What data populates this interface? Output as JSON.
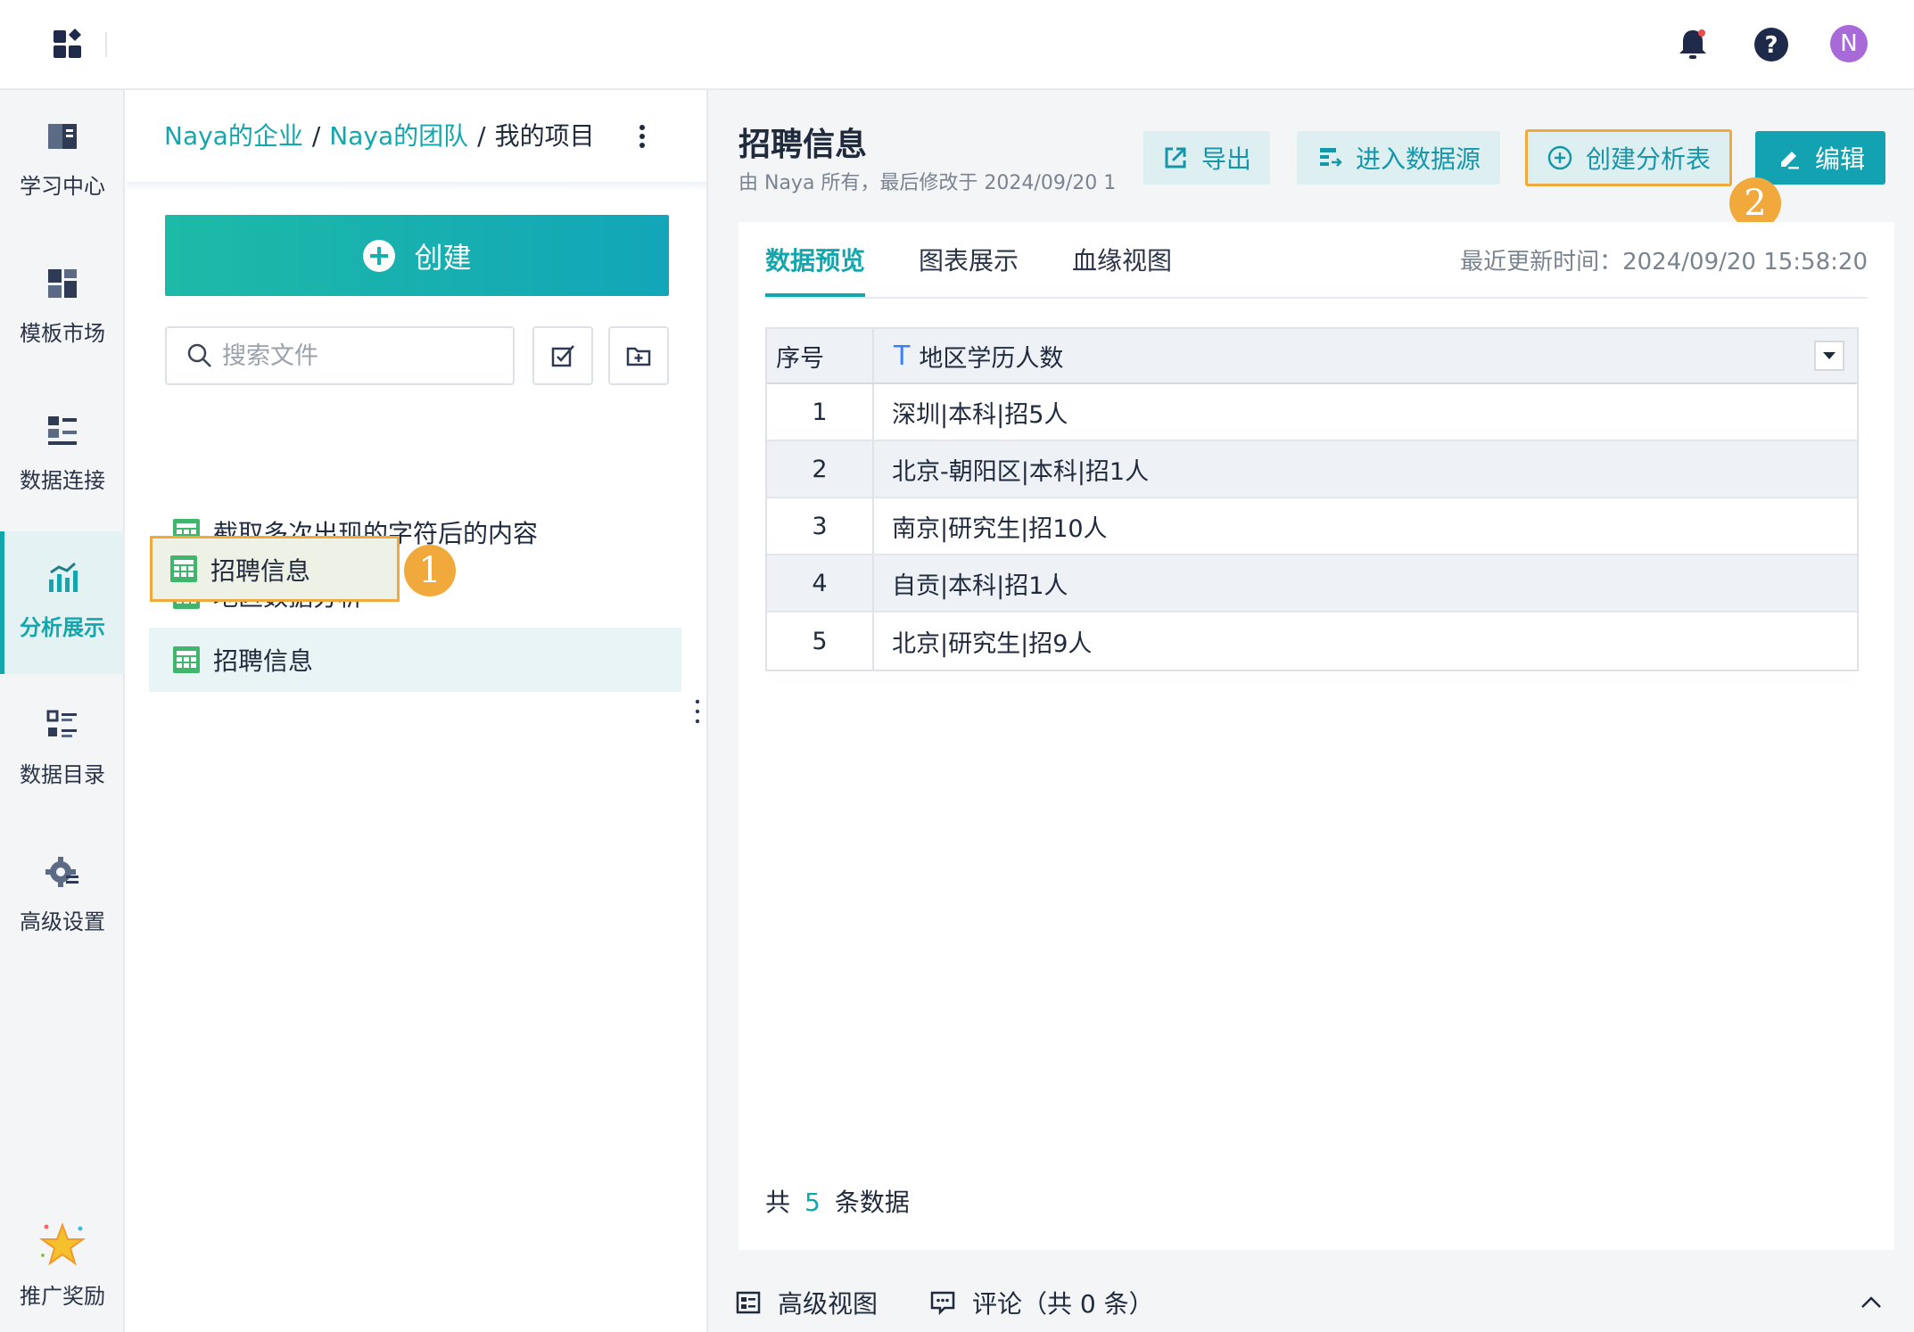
{
  "topbar": {
    "logo_icon": "apps-grid-icon",
    "notification_icon": "bell-icon",
    "help_icon": "help-circle-icon",
    "avatar_initial": "N",
    "avatar_color": "#a86ad8"
  },
  "leftnav": {
    "items": [
      {
        "label": "学习中心",
        "icon": "book-icon"
      },
      {
        "label": "模板市场",
        "icon": "template-grid-icon"
      },
      {
        "label": "数据连接",
        "icon": "data-connect-icon"
      },
      {
        "label": "分析展示",
        "icon": "analysis-chart-icon",
        "active": true
      },
      {
        "label": "数据目录",
        "icon": "catalog-list-icon"
      },
      {
        "label": "高级设置",
        "icon": "gear-icon"
      }
    ],
    "reward": {
      "label": "推广奖励",
      "icon": "star-icon"
    }
  },
  "filepanel": {
    "breadcrumb": [
      "Naya的企业",
      "Naya的团队",
      "我的项目"
    ],
    "create_label": "创建",
    "search_placeholder": "搜索文件",
    "files": [
      {
        "label": "截取多次出现的字符后的内容"
      },
      {
        "label": "地区数据分析"
      },
      {
        "label": "招聘信息",
        "selected": true
      }
    ],
    "step1_badge": "1"
  },
  "main": {
    "title": "招聘信息",
    "subtitle": "由 Naya 所有，最后修改于 2024/09/20 1",
    "actions": {
      "export": "导出",
      "enter_source": "进入数据源",
      "create_analysis": "创建分析表",
      "edit": "编辑"
    },
    "step2_badge": "2",
    "tabs": [
      "数据预览",
      "图表展示",
      "血缘视图"
    ],
    "active_tab": "数据预览",
    "update_time": "最近更新时间：2024/09/20 15:58:20",
    "table": {
      "headers": [
        "序号",
        "地区学历人数"
      ],
      "type_marker": "T",
      "rows": [
        {
          "idx": "1",
          "value": "深圳|本科|招5人"
        },
        {
          "idx": "2",
          "value": "北京-朝阳区|本科|招1人"
        },
        {
          "idx": "3",
          "value": "南京|研究生|招10人"
        },
        {
          "idx": "4",
          "value": "自贡|本科|招1人"
        },
        {
          "idx": "5",
          "value": "北京|研究生|招9人"
        }
      ]
    },
    "row_count": {
      "prefix": "共",
      "count": "5",
      "suffix": "条数据"
    },
    "bottom": {
      "advanced_view": "高级视图",
      "comments": "评论（共 0 条）"
    }
  },
  "colors": {
    "accent": "#14a6ad",
    "highlight": "#f0a93c"
  }
}
